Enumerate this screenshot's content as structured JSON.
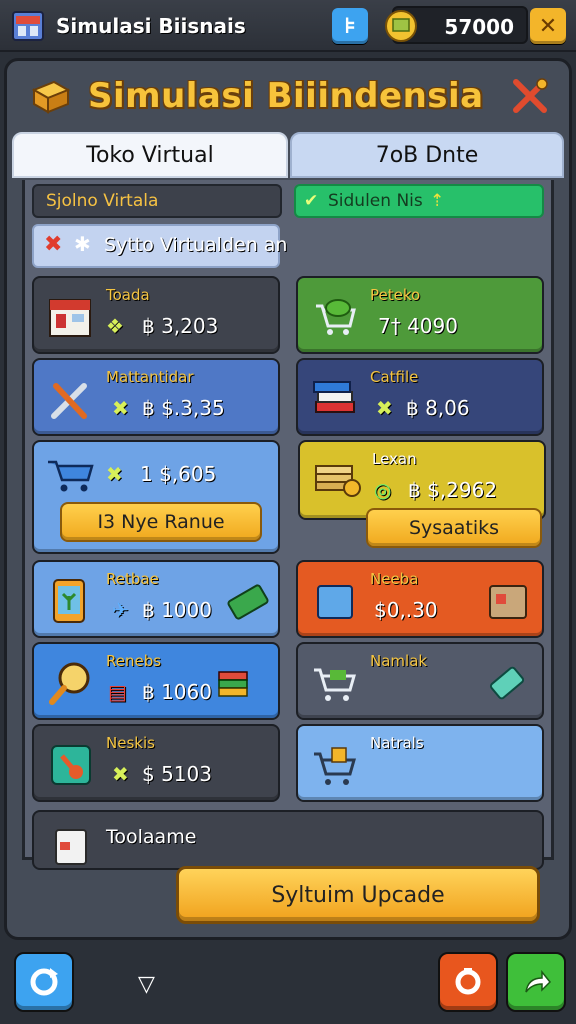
{
  "header": {
    "app_title": "Simulasi Biisnais",
    "coin_value": "57000",
    "app_icon": "store-building-icon",
    "help_icon": "blue-square-icon",
    "coin_icon": "gold-coin-stack-icon",
    "close_icon": "close-icon"
  },
  "banner": {
    "title": "Simulasi Biiindensia",
    "left_icon": "cash-box-icon",
    "right_icon": "crossed-tools-icon"
  },
  "tabs": [
    {
      "label": "Toko Virtual"
    },
    {
      "label": "7oB Dnte"
    }
  ],
  "subheader": {
    "left_label": "Sjolno Virtala",
    "right_label": "Sidulen Nis",
    "search_text": "Sytto Virtualden an",
    "right_check_icon": "check-icon",
    "right_arrow_icon": "arrow-up-icon"
  },
  "cards": [
    {
      "label": "Toada",
      "value": "฿ 3,203",
      "icon": "shop-front-icon",
      "glyph": "❖",
      "color": "#3f434d"
    },
    {
      "label": "Peteko",
      "value": "7† 4090",
      "icon": "cart-money-icon",
      "glyph": "",
      "color": "#4e9a3a"
    },
    {
      "label": "Mattantidar",
      "value": "฿ $.3,35",
      "icon": "wrench-tool-icon",
      "glyph": "✖",
      "color": "#4f78c6"
    },
    {
      "label": "Catfile",
      "value": "฿ 8,06",
      "icon": "books-icon",
      "glyph": "✖",
      "color": "#36467a"
    },
    {
      "label": "",
      "value": "1 $,605",
      "icon": "blue-cart-icon",
      "glyph": "✖",
      "color": "#6ea3e6"
    },
    {
      "label": "Lexan",
      "value": "฿ $,2962",
      "icon": "money-stack-icon",
      "glyph": "◎",
      "color": "#d9c12b"
    },
    {
      "label": "Retbae",
      "value": "฿ 1000",
      "icon": "tablet-plant-icon",
      "glyph": "✈",
      "color": "#6ea3e6"
    },
    {
      "label": "Neeba",
      "value": "$0,.30",
      "icon": "box-icon",
      "glyph": "",
      "color": "#e45a22"
    },
    {
      "label": "Renebs",
      "value": "฿ 1060",
      "icon": "magnifier-icon",
      "glyph": "▤",
      "color": "#3f86de"
    },
    {
      "label": "Namlak",
      "value": "",
      "icon": "cart-icon",
      "glyph": "",
      "color": "#535a6a"
    },
    {
      "label": "Neskis",
      "value": "$ 5103",
      "icon": "joystick-icon",
      "glyph": "✖",
      "color": "#3f434d"
    },
    {
      "label": "Natrals",
      "value": "",
      "icon": "cart-gold-icon",
      "glyph": "",
      "color": "#7eb3ee"
    }
  ],
  "card_buttons": {
    "left": "I3 Nye Ranue",
    "right": "Sysaatiks"
  },
  "bottom_card": {
    "label": "Toolaame",
    "icon": "cup-icon"
  },
  "upgrade_button": "Syltuim Upcade",
  "nav": {
    "left_icon": "refresh-icon",
    "middle_icon": "triangle-down-icon",
    "right_red_icon": "cycle-icon",
    "right_green_icon": "share-arrow-icon"
  }
}
